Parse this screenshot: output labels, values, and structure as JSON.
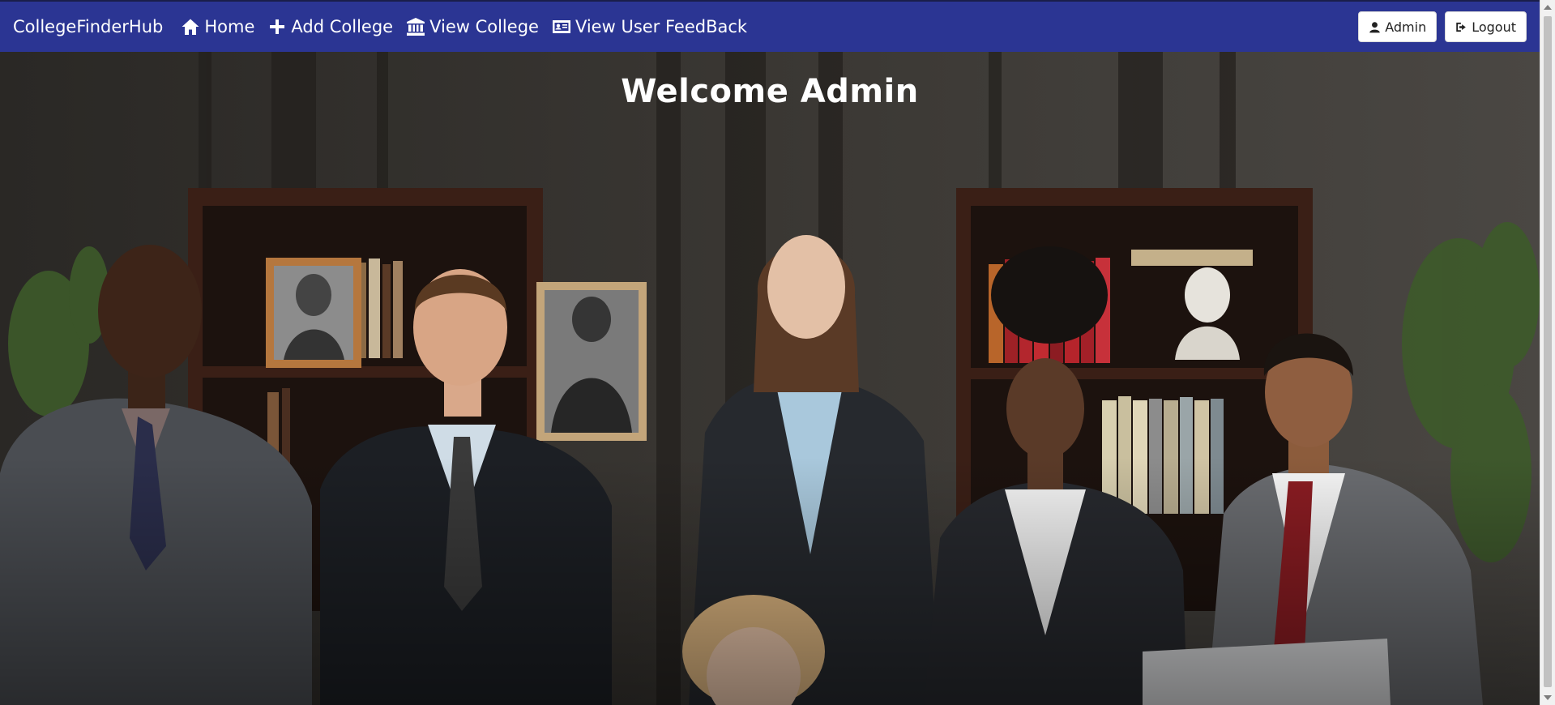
{
  "navbar": {
    "brand": "CollegeFinderHub",
    "links": [
      {
        "label": "Home",
        "icon": "home-icon"
      },
      {
        "label": "Add College",
        "icon": "plus-icon"
      },
      {
        "label": "View College",
        "icon": "institution-icon"
      },
      {
        "label": "View User FeedBack",
        "icon": "id-card-icon"
      }
    ],
    "user_button": "Admin",
    "logout_button": "Logout"
  },
  "hero": {
    "heading": "Welcome Admin",
    "image": "group-photo-business-team"
  },
  "colors": {
    "navbar_bg": "#2b3593",
    "text_light": "#ffffff"
  }
}
